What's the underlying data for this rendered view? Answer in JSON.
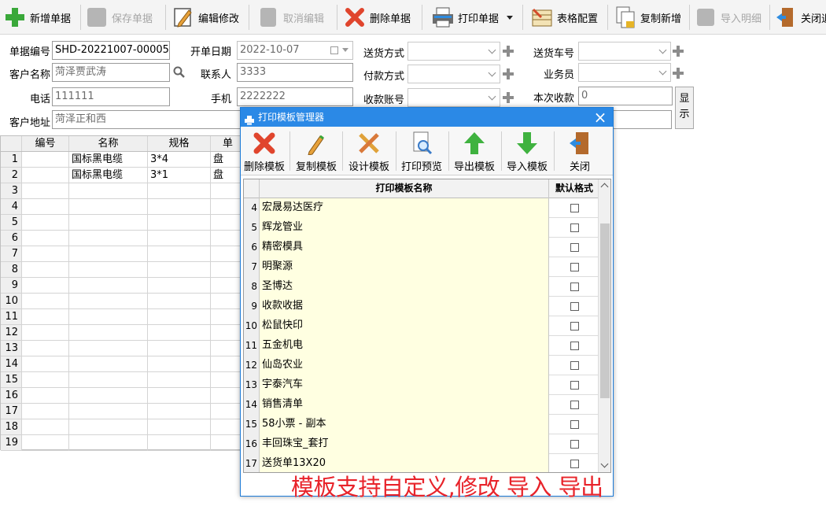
{
  "toolbar": {
    "buttons": [
      {
        "label": "新增单据",
        "icon": "plus-icon",
        "enabled": true
      },
      {
        "label": "保存单据",
        "icon": "save-icon",
        "enabled": false
      },
      {
        "label": "编辑修改",
        "icon": "edit-icon",
        "enabled": true
      },
      {
        "label": "取消编辑",
        "icon": "cancel-edit-icon",
        "enabled": false
      },
      {
        "label": "删除单据",
        "icon": "delete-icon",
        "enabled": true
      },
      {
        "label": "打印单据",
        "icon": "printer-icon",
        "enabled": true,
        "has_dropdown": true
      },
      {
        "label": "表格配置",
        "icon": "table-config-icon",
        "enabled": true
      },
      {
        "label": "复制新增",
        "icon": "copy-icon",
        "enabled": true
      },
      {
        "label": "导入明细",
        "icon": "import-detail-icon",
        "enabled": false
      },
      {
        "label": "关闭退",
        "icon": "exit-door-icon",
        "enabled": true
      }
    ]
  },
  "form": {
    "doc_no": {
      "label": "单据编号",
      "value": "SHD-20221007-00005"
    },
    "open_date": {
      "label": "开单日期",
      "value": "2022-10-07"
    },
    "delivery_method": {
      "label": "送货方式",
      "value": ""
    },
    "delivery_vehicle": {
      "label": "送货车号",
      "value": ""
    },
    "customer_name": {
      "label": "客户名称",
      "value": "菏泽贾武涛"
    },
    "contact": {
      "label": "联系人",
      "value": "3333"
    },
    "payment_method": {
      "label": "付款方式",
      "value": ""
    },
    "salesperson": {
      "label": "业务员",
      "value": ""
    },
    "phone": {
      "label": "电话",
      "value": "111111"
    },
    "mobile": {
      "label": "手机",
      "value": "2222222"
    },
    "account_no": {
      "label": "收款账号",
      "value": ""
    },
    "received": {
      "label": "本次收款",
      "value": "0"
    },
    "address": {
      "label": "客户地址",
      "value": "菏泽正和西"
    },
    "show_button": "显示"
  },
  "grid": {
    "columns": [
      "编号",
      "名称",
      "规格",
      "单"
    ],
    "rows": [
      {
        "n": "1",
        "code": "",
        "name": "国标黑电缆",
        "spec": "3*4",
        "unit": "盘"
      },
      {
        "n": "2",
        "code": "",
        "name": "国标黑电缆",
        "spec": "3*1",
        "unit": "盘"
      },
      {
        "n": "3"
      },
      {
        "n": "4"
      },
      {
        "n": "5"
      },
      {
        "n": "6"
      },
      {
        "n": "7"
      },
      {
        "n": "8"
      },
      {
        "n": "9"
      },
      {
        "n": "10"
      },
      {
        "n": "11"
      },
      {
        "n": "12"
      },
      {
        "n": "13"
      },
      {
        "n": "14"
      },
      {
        "n": "15"
      },
      {
        "n": "16"
      },
      {
        "n": "17"
      },
      {
        "n": "18"
      },
      {
        "n": "19"
      }
    ]
  },
  "dialog": {
    "title": "打印模板管理器",
    "buttons": [
      {
        "label": "删除模板",
        "icon": "delete-icon"
      },
      {
        "label": "复制模板",
        "icon": "copy-pencil-icon"
      },
      {
        "label": "设计模板",
        "icon": "design-tools-icon"
      },
      {
        "label": "打印预览",
        "icon": "print-preview-icon"
      },
      {
        "label": "导出模板",
        "icon": "export-up-arrow-icon"
      },
      {
        "label": "导入模板",
        "icon": "import-down-arrow-icon"
      },
      {
        "label": "关闭",
        "icon": "exit-door-icon"
      }
    ],
    "columns": [
      "打印模板名称",
      "默认格式"
    ],
    "rows": [
      {
        "n": "4",
        "name": "宏晟易达医疗",
        "default": false
      },
      {
        "n": "5",
        "name": "辉龙管业",
        "default": false
      },
      {
        "n": "6",
        "name": "精密模具",
        "default": false
      },
      {
        "n": "7",
        "name": "明聚源",
        "default": false
      },
      {
        "n": "8",
        "name": "圣博达",
        "default": false
      },
      {
        "n": "9",
        "name": "收款收据",
        "default": false
      },
      {
        "n": "10",
        "name": "松鼠快印",
        "default": false
      },
      {
        "n": "11",
        "name": "五金机电",
        "default": false
      },
      {
        "n": "12",
        "name": "仙岛农业",
        "default": false
      },
      {
        "n": "13",
        "name": "宇泰汽车",
        "default": false
      },
      {
        "n": "14",
        "name": "销售清单",
        "default": false
      },
      {
        "n": "15",
        "name": "58小票 - 副本",
        "default": false
      },
      {
        "n": "16",
        "name": "丰回珠宝_套打",
        "default": false
      },
      {
        "n": "17",
        "name": "送货单13X20",
        "default": false
      }
    ]
  },
  "promo_text": "模板支持自定义,修改 导入 导出",
  "colors": {
    "accent": "#2b89e6",
    "promo": "#e8232a",
    "name_cell": "#ffffe1"
  }
}
